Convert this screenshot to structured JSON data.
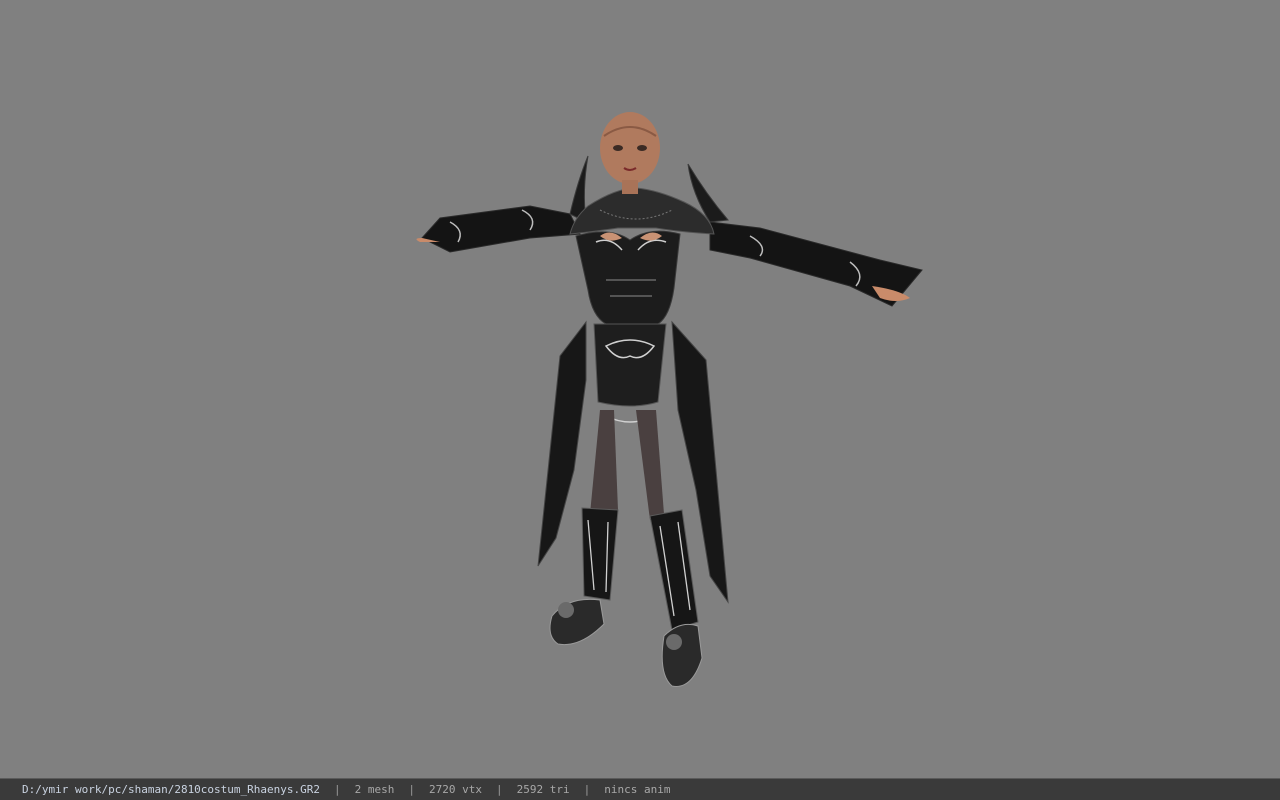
{
  "viewport": {
    "background_color": "#808080",
    "model_description_icon": "character-model"
  },
  "statusbar": {
    "file_path": "D:/ymir work/pc/shaman/2810costum_Rhaenys.GR2",
    "separator": "|",
    "mesh_count": "2 mesh",
    "vertex_count": "2720 vtx",
    "triangle_count": "2592 tri",
    "anim_status": "nincs anim"
  }
}
